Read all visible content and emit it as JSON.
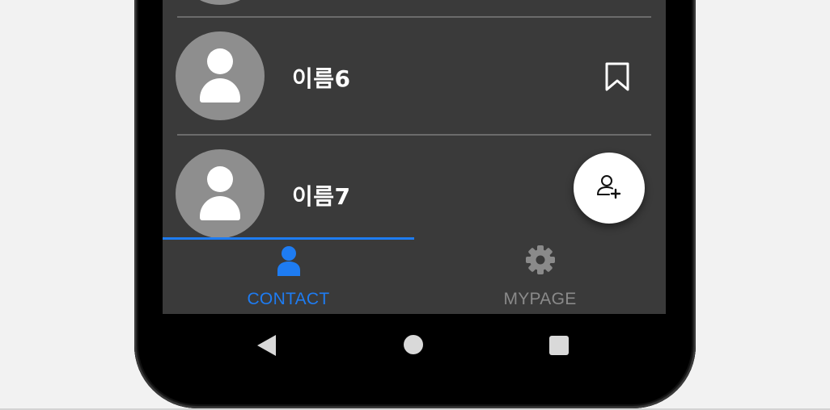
{
  "contacts": [
    {
      "name": "이름6",
      "bookmarked": true
    },
    {
      "name": "이름7",
      "bookmarked": false
    }
  ],
  "fab": {
    "icon": "add-person-icon"
  },
  "bottom_nav": {
    "tabs": [
      {
        "label": "CONTACT",
        "icon": "person-icon",
        "active": true,
        "color": "#1e7cf2"
      },
      {
        "label": "MYPAGE",
        "icon": "gear-icon",
        "active": false,
        "color": "#8a8a8a"
      }
    ]
  },
  "system_nav": {
    "buttons": [
      "back-icon",
      "home-icon",
      "recents-icon"
    ]
  },
  "colors": {
    "screen_bg": "#3a3a3a",
    "accent": "#1e7cf2",
    "avatar_bg": "#8e8e8e"
  }
}
